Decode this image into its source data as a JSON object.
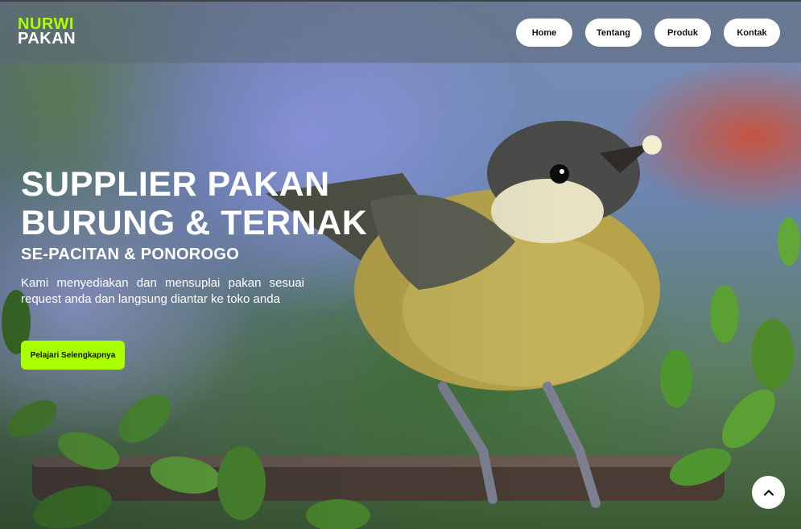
{
  "brand": {
    "line1": "NURWI",
    "line2": "PAKAN",
    "accent_color": "#aaff00"
  },
  "nav": {
    "items": [
      {
        "label": "Home"
      },
      {
        "label": "Tentang"
      },
      {
        "label": "Produk"
      },
      {
        "label": "Kontak"
      }
    ]
  },
  "hero": {
    "headline_line1": "SUPPLIER PAKAN",
    "headline_line2": "BURUNG & TERNAK",
    "subheadline": "SE-PACITAN & PONOROGO",
    "description": "Kami menyediakan dan mensuplai pakan sesuai request anda dan langsung diantar ke toko anda",
    "cta_label": "Pelajari Selengkapnya"
  },
  "icons": {
    "scroll_top": "chevron-up-icon"
  }
}
